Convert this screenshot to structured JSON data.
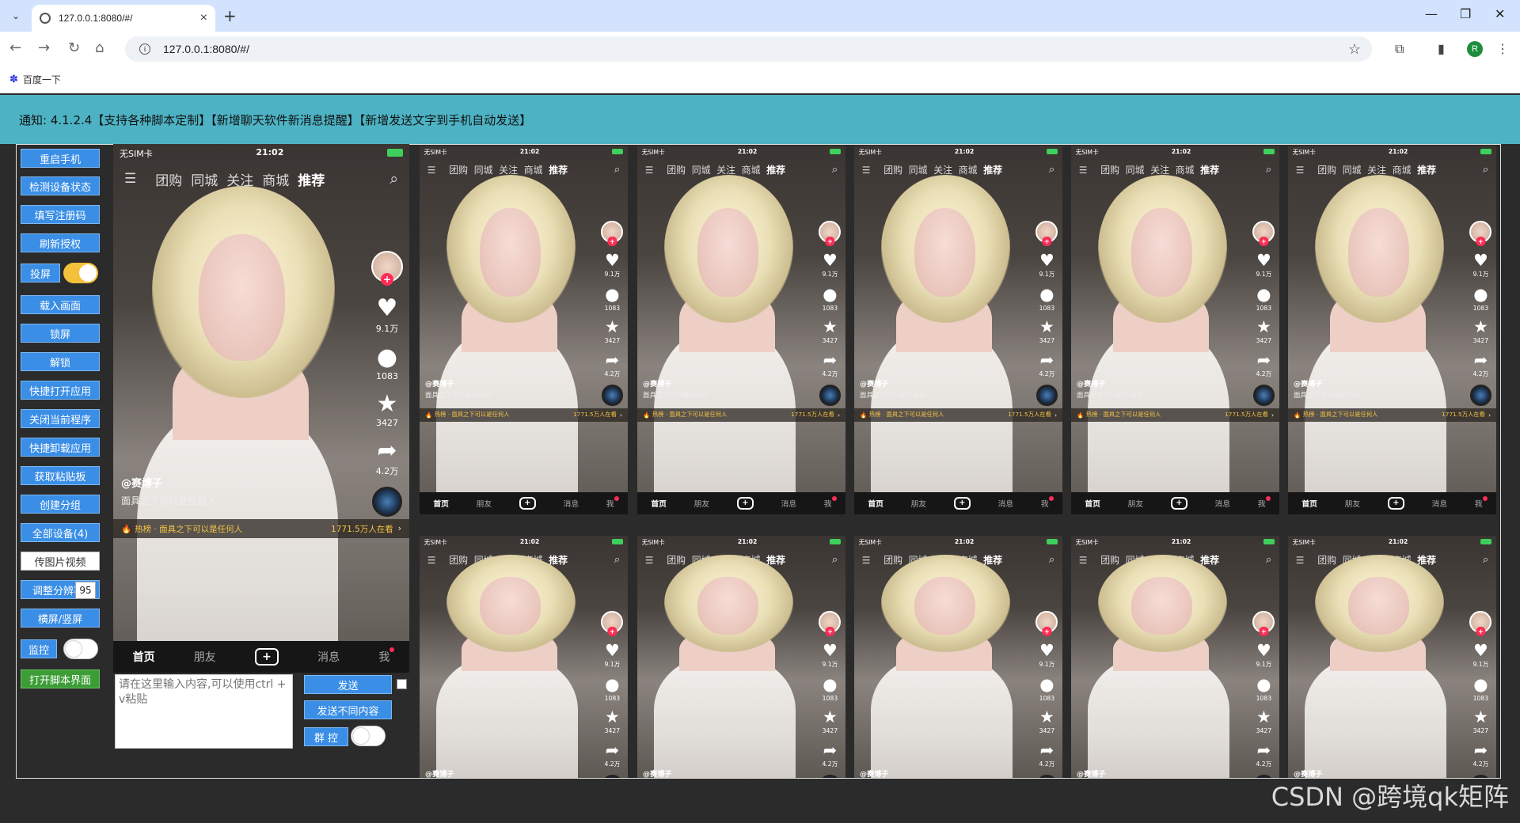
{
  "browser": {
    "tab_title": "127.0.0.1:8080/#/",
    "url": "127.0.0.1:8080/#/",
    "profile_initial": "R",
    "bookmark": "百度一下",
    "new_tab": "+",
    "tab_close": "×"
  },
  "notice": "通知:   4.1.2.4【支持各种脚本定制】【新增聊天软件新消息提醒】【新增发送文字到手机自动发送】",
  "sidebar": {
    "restart": "重启手机",
    "check_status": "检测设备状态",
    "register": "填写注册码",
    "refresh_auth": "刷新授权",
    "cast": "投屏",
    "cast_on": true,
    "load_screen": "载入画面",
    "lock": "锁屏",
    "unlock": "解锁",
    "quick_open": "快捷打开应用",
    "close_current": "关闭当前程序",
    "quick_uninstall": "快捷卸载应用",
    "clipboard": "获取粘贴板",
    "create_group": "创建分组",
    "all_devices": "全部设备(4)",
    "upload_media": "传图片视频",
    "resolution": "调整分辨率",
    "resolution_value": "95",
    "orientation": "横屏/竖屏",
    "monitor": "监控",
    "monitor_on": false,
    "open_script": "打开脚本界面"
  },
  "input": {
    "placeholder": "请在这里输入内容,可以使用ctrl + v粘贴",
    "send": "发送",
    "send_different": "发送不同内容",
    "group_control": "群 控",
    "group_control_on": false
  },
  "phone": {
    "carrier": "无SIM卡",
    "time": "21:02",
    "nav": [
      "团购",
      "同城",
      "关注",
      "商城",
      "推荐"
    ],
    "likes": "9.1万",
    "comments": "1083",
    "favorites": "3427",
    "shares": "4.2万",
    "author": "@赛博子",
    "caption": "面具之下可以是任何人",
    "hot_label": "热榜 · 面具之下可以是任何人",
    "hot_watching": "1771.5万人在看",
    "bottom_nav": [
      "首页",
      "朋友",
      "+",
      "消息",
      "我"
    ]
  },
  "watermark": "CSDN @跨境qk矩阵",
  "colors": {
    "notice_bg": "#4db3c4",
    "button_blue": "#3a8ee6",
    "button_green": "#3c9d36",
    "toggle_on": "#f3c13a",
    "tiktok_red": "#fe2c55",
    "hot_yellow": "#f6c343"
  }
}
